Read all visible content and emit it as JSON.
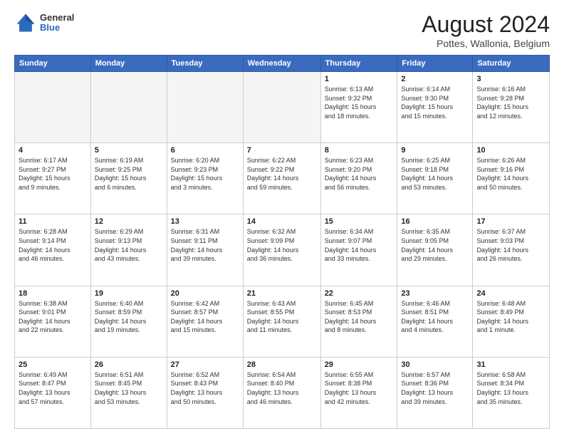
{
  "header": {
    "logo_general": "General",
    "logo_blue": "Blue",
    "month_title": "August 2024",
    "location": "Pottes, Wallonia, Belgium"
  },
  "weekdays": [
    "Sunday",
    "Monday",
    "Tuesday",
    "Wednesday",
    "Thursday",
    "Friday",
    "Saturday"
  ],
  "weeks": [
    [
      {
        "day": "",
        "info": ""
      },
      {
        "day": "",
        "info": ""
      },
      {
        "day": "",
        "info": ""
      },
      {
        "day": "",
        "info": ""
      },
      {
        "day": "1",
        "info": "Sunrise: 6:13 AM\nSunset: 9:32 PM\nDaylight: 15 hours\nand 18 minutes."
      },
      {
        "day": "2",
        "info": "Sunrise: 6:14 AM\nSunset: 9:30 PM\nDaylight: 15 hours\nand 15 minutes."
      },
      {
        "day": "3",
        "info": "Sunrise: 6:16 AM\nSunset: 9:28 PM\nDaylight: 15 hours\nand 12 minutes."
      }
    ],
    [
      {
        "day": "4",
        "info": "Sunrise: 6:17 AM\nSunset: 9:27 PM\nDaylight: 15 hours\nand 9 minutes."
      },
      {
        "day": "5",
        "info": "Sunrise: 6:19 AM\nSunset: 9:25 PM\nDaylight: 15 hours\nand 6 minutes."
      },
      {
        "day": "6",
        "info": "Sunrise: 6:20 AM\nSunset: 9:23 PM\nDaylight: 15 hours\nand 3 minutes."
      },
      {
        "day": "7",
        "info": "Sunrise: 6:22 AM\nSunset: 9:22 PM\nDaylight: 14 hours\nand 59 minutes."
      },
      {
        "day": "8",
        "info": "Sunrise: 6:23 AM\nSunset: 9:20 PM\nDaylight: 14 hours\nand 56 minutes."
      },
      {
        "day": "9",
        "info": "Sunrise: 6:25 AM\nSunset: 9:18 PM\nDaylight: 14 hours\nand 53 minutes."
      },
      {
        "day": "10",
        "info": "Sunrise: 6:26 AM\nSunset: 9:16 PM\nDaylight: 14 hours\nand 50 minutes."
      }
    ],
    [
      {
        "day": "11",
        "info": "Sunrise: 6:28 AM\nSunset: 9:14 PM\nDaylight: 14 hours\nand 46 minutes."
      },
      {
        "day": "12",
        "info": "Sunrise: 6:29 AM\nSunset: 9:13 PM\nDaylight: 14 hours\nand 43 minutes."
      },
      {
        "day": "13",
        "info": "Sunrise: 6:31 AM\nSunset: 9:11 PM\nDaylight: 14 hours\nand 39 minutes."
      },
      {
        "day": "14",
        "info": "Sunrise: 6:32 AM\nSunset: 9:09 PM\nDaylight: 14 hours\nand 36 minutes."
      },
      {
        "day": "15",
        "info": "Sunrise: 6:34 AM\nSunset: 9:07 PM\nDaylight: 14 hours\nand 33 minutes."
      },
      {
        "day": "16",
        "info": "Sunrise: 6:35 AM\nSunset: 9:05 PM\nDaylight: 14 hours\nand 29 minutes."
      },
      {
        "day": "17",
        "info": "Sunrise: 6:37 AM\nSunset: 9:03 PM\nDaylight: 14 hours\nand 26 minutes."
      }
    ],
    [
      {
        "day": "18",
        "info": "Sunrise: 6:38 AM\nSunset: 9:01 PM\nDaylight: 14 hours\nand 22 minutes."
      },
      {
        "day": "19",
        "info": "Sunrise: 6:40 AM\nSunset: 8:59 PM\nDaylight: 14 hours\nand 19 minutes."
      },
      {
        "day": "20",
        "info": "Sunrise: 6:42 AM\nSunset: 8:57 PM\nDaylight: 14 hours\nand 15 minutes."
      },
      {
        "day": "21",
        "info": "Sunrise: 6:43 AM\nSunset: 8:55 PM\nDaylight: 14 hours\nand 11 minutes."
      },
      {
        "day": "22",
        "info": "Sunrise: 6:45 AM\nSunset: 8:53 PM\nDaylight: 14 hours\nand 8 minutes."
      },
      {
        "day": "23",
        "info": "Sunrise: 6:46 AM\nSunset: 8:51 PM\nDaylight: 14 hours\nand 4 minutes."
      },
      {
        "day": "24",
        "info": "Sunrise: 6:48 AM\nSunset: 8:49 PM\nDaylight: 14 hours\nand 1 minute."
      }
    ],
    [
      {
        "day": "25",
        "info": "Sunrise: 6:49 AM\nSunset: 8:47 PM\nDaylight: 13 hours\nand 57 minutes."
      },
      {
        "day": "26",
        "info": "Sunrise: 6:51 AM\nSunset: 8:45 PM\nDaylight: 13 hours\nand 53 minutes."
      },
      {
        "day": "27",
        "info": "Sunrise: 6:52 AM\nSunset: 8:43 PM\nDaylight: 13 hours\nand 50 minutes."
      },
      {
        "day": "28",
        "info": "Sunrise: 6:54 AM\nSunset: 8:40 PM\nDaylight: 13 hours\nand 46 minutes."
      },
      {
        "day": "29",
        "info": "Sunrise: 6:55 AM\nSunset: 8:38 PM\nDaylight: 13 hours\nand 42 minutes."
      },
      {
        "day": "30",
        "info": "Sunrise: 6:57 AM\nSunset: 8:36 PM\nDaylight: 13 hours\nand 39 minutes."
      },
      {
        "day": "31",
        "info": "Sunrise: 6:58 AM\nSunset: 8:34 PM\nDaylight: 13 hours\nand 35 minutes."
      }
    ]
  ]
}
